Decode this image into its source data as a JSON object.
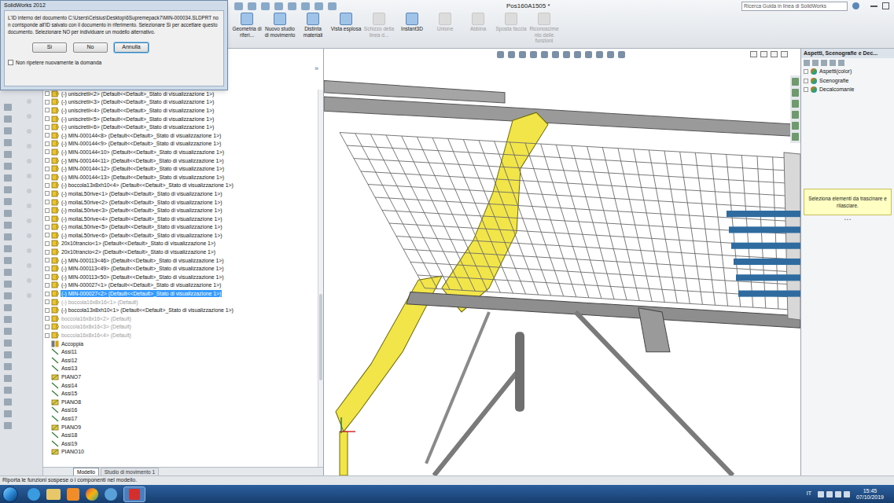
{
  "window": {
    "app": "SolidWorks 2012",
    "title": "Pos160A1505 *"
  },
  "search": {
    "placeholder": "Ricerca Guida in linea di SolidWorks"
  },
  "ribbon": {
    "buttons": [
      {
        "label": "Geometria di riferi...",
        "disabled": false
      },
      {
        "label": "Nuovo studio di movimento",
        "disabled": false
      },
      {
        "label": "Distinta materiali",
        "disabled": false
      },
      {
        "label": "Vista esplosa",
        "disabled": false
      },
      {
        "label": "Schizzo della linea d...",
        "disabled": true
      },
      {
        "label": "Instant3D",
        "disabled": false
      },
      {
        "label": "Unione",
        "disabled": true
      },
      {
        "label": "Abbina",
        "disabled": true
      },
      {
        "label": "Sposta faccia",
        "disabled": true
      },
      {
        "label": "Riconoscimento delle funzioni",
        "disabled": true
      }
    ]
  },
  "dialog": {
    "title": "SolidWorks 2012",
    "message": "L'ID interno del documento C:\\Users\\Celsius\\Desktop\\6Supremepack7\\MIN-000034.SLDPRT non corrisponde all'ID salvato con il documento in riferimento.  Selezionare Sì per accettare questo documento.  Selezionare NO per individuare un modello alternativo.",
    "buttons": [
      {
        "label": "Sì",
        "selected": false
      },
      {
        "label": "No",
        "selected": false
      },
      {
        "label": "Annulla",
        "selected": true
      }
    ],
    "checkbox": {
      "label": "Non ripetere nuovamente la domanda",
      "checked": false
    }
  },
  "tree": {
    "collapse": "»",
    "rows": [
      {
        "label": "(-) unisciretii<2> (Default<<Default>_Stato di visualizzazione 1>)",
        "kind": "component",
        "suppressed": false,
        "selected": false
      },
      {
        "label": "(-) unisciretii<3> (Default<<Default>_Stato di visualizzazione 1>)",
        "kind": "component",
        "suppressed": false,
        "selected": false
      },
      {
        "label": "(-) unisciretii<4> (Default<<Default>_Stato di visualizzazione 1>)",
        "kind": "component",
        "suppressed": false,
        "selected": false
      },
      {
        "label": "(-) unisciretii<5> (Default<<Default>_Stato di visualizzazione 1>)",
        "kind": "component",
        "suppressed": false,
        "selected": false
      },
      {
        "label": "(-) unisciretii<6> (Default<<Default>_Stato di visualizzazione 1>)",
        "kind": "component",
        "suppressed": false,
        "selected": false
      },
      {
        "label": "(-) MIN-000144<8> (Default<<Default>_Stato di visualizzazione 1>)",
        "kind": "component",
        "suppressed": false,
        "selected": false
      },
      {
        "label": "(-) MIN-000144<9> (Default<<Default>_Stato di visualizzazione 1>)",
        "kind": "component",
        "suppressed": false,
        "selected": false
      },
      {
        "label": "(-) MIN-000144<10> (Default<<Default>_Stato di visualizzazione 1>)",
        "kind": "component",
        "suppressed": false,
        "selected": false
      },
      {
        "label": "(-) MIN-000144<11> (Default<<Default>_Stato di visualizzazione 1>)",
        "kind": "component",
        "suppressed": false,
        "selected": false
      },
      {
        "label": "(-) MIN-000144<12> (Default<<Default>_Stato di visualizzazione 1>)",
        "kind": "component",
        "suppressed": false,
        "selected": false
      },
      {
        "label": "(-) MIN-000144<13> (Default<<Default>_Stato di visualizzazione 1>)",
        "kind": "component",
        "suppressed": false,
        "selected": false
      },
      {
        "label": "(-) boccola13x8xh10<4> (Default<<Default>_Stato di visualizzazione 1>)",
        "kind": "component",
        "suppressed": false,
        "selected": false
      },
      {
        "label": "(-) mollaL50rive<1> (Default<<Default>_Stato di visualizzazione 1>)",
        "kind": "component",
        "suppressed": false,
        "selected": false
      },
      {
        "label": "(-) mollaL50rive<2> (Default<<Default>_Stato di visualizzazione 1>)",
        "kind": "component",
        "suppressed": false,
        "selected": false
      },
      {
        "label": "(-) mollaL50rive<3> (Default<<Default>_Stato di visualizzazione 1>)",
        "kind": "component",
        "suppressed": false,
        "selected": false
      },
      {
        "label": "(-) mollaL50rive<4> (Default<<Default>_Stato di visualizzazione 1>)",
        "kind": "component",
        "suppressed": false,
        "selected": false
      },
      {
        "label": "(-) mollaL50rive<5> (Default<<Default>_Stato di visualizzazione 1>)",
        "kind": "component",
        "suppressed": false,
        "selected": false
      },
      {
        "label": "(-) mollaL50rive<6> (Default<<Default>_Stato di visualizzazione 1>)",
        "kind": "component",
        "suppressed": false,
        "selected": false
      },
      {
        "label": "20x10trancio<1> (Default<<Default>_Stato di visualizzazione 1>)",
        "kind": "component",
        "suppressed": false,
        "selected": false
      },
      {
        "label": "20x10trancio<2> (Default<<Default>_Stato di visualizzazione 1>)",
        "kind": "component",
        "suppressed": false,
        "selected": false
      },
      {
        "label": "(-) MIN-000113<46> (Default<<Default>_Stato di visualizzazione 1>)",
        "kind": "component",
        "suppressed": false,
        "selected": false
      },
      {
        "label": "(-) MIN-000113<49> (Default<<Default>_Stato di visualizzazione 1>)",
        "kind": "component",
        "suppressed": false,
        "selected": false
      },
      {
        "label": "(-) MIN-000113<50> (Default<<Default>_Stato di visualizzazione 1>)",
        "kind": "component",
        "suppressed": false,
        "selected": false
      },
      {
        "label": "(-) MIN-000027<1> (Default<<Default>_Stato di visualizzazione 1>)",
        "kind": "component",
        "suppressed": false,
        "selected": false
      },
      {
        "label": "(-) MIN-000027<2> (Default<<Default>_Stato di visualizzazione 1>)",
        "kind": "component",
        "suppressed": false,
        "selected": true
      },
      {
        "label": "(-) boccola16x8x16<1> (Default)",
        "kind": "component",
        "suppressed": true,
        "selected": false
      },
      {
        "label": "(-) boccola13x8xh10<1> (Default<<Default>_Stato di visualizzazione 1>)",
        "kind": "component",
        "suppressed": false,
        "selected": false
      },
      {
        "label": "boccola16x8x16<2> (Default)",
        "kind": "component",
        "suppressed": true,
        "selected": false
      },
      {
        "label": "boccola16x8x16<3> (Default)",
        "kind": "component",
        "suppressed": true,
        "selected": false
      },
      {
        "label": "boccola16x8x16<4> (Default)",
        "kind": "component",
        "suppressed": true,
        "selected": false
      },
      {
        "label": "Accoppia",
        "kind": "folder",
        "suppressed": false,
        "selected": false
      },
      {
        "label": "Assi11",
        "kind": "axis",
        "suppressed": false,
        "selected": false
      },
      {
        "label": "Assi12",
        "kind": "axis",
        "suppressed": false,
        "selected": false
      },
      {
        "label": "Assi13",
        "kind": "axis",
        "suppressed": false,
        "selected": false
      },
      {
        "label": "PIANO7",
        "kind": "plane",
        "suppressed": false,
        "selected": false
      },
      {
        "label": "Assi14",
        "kind": "axis",
        "suppressed": false,
        "selected": false
      },
      {
        "label": "Assi15",
        "kind": "axis",
        "suppressed": false,
        "selected": false
      },
      {
        "label": "PIANO8",
        "kind": "plane",
        "suppressed": false,
        "selected": false
      },
      {
        "label": "Assi16",
        "kind": "axis",
        "suppressed": false,
        "selected": false
      },
      {
        "label": "Assi17",
        "kind": "axis",
        "suppressed": false,
        "selected": false
      },
      {
        "label": "PIANO9",
        "kind": "plane",
        "suppressed": false,
        "selected": false
      },
      {
        "label": "Assi18",
        "kind": "axis",
        "suppressed": false,
        "selected": false
      },
      {
        "label": "Assi19",
        "kind": "axis",
        "suppressed": false,
        "selected": false
      },
      {
        "label": "PIANO10",
        "kind": "plane",
        "suppressed": false,
        "selected": false
      }
    ]
  },
  "tabs": [
    {
      "label": "Modello",
      "selected": true
    },
    {
      "label": "Studio di movimento 1",
      "selected": false
    }
  ],
  "taskpane": {
    "title": "Aspetti, Scenografie e Dec...",
    "items": [
      "Aspetti(color)",
      "Scenografie",
      "Decalcomanie"
    ],
    "tooltip": "Seleziona elementi da trascinare e rilasciare.",
    "grip": "• • •"
  },
  "status_bar": "Riporta le funzioni sospese o i componenti nel modello.",
  "taskbar": {
    "language": "IT",
    "time": "15:45",
    "date": "07/10/2019"
  }
}
